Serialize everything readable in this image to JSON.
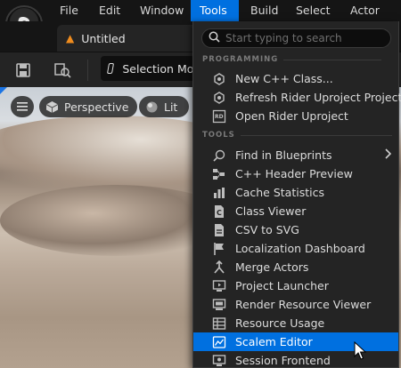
{
  "menubar": {
    "items": [
      {
        "label": "File"
      },
      {
        "label": "Edit"
      },
      {
        "label": "Window"
      },
      {
        "label": "Tools"
      },
      {
        "label": "Build"
      },
      {
        "label": "Select"
      },
      {
        "label": "Actor"
      }
    ],
    "active": "Tools"
  },
  "document_tab": {
    "label": "Untitled",
    "icon": "level-icon"
  },
  "toolbar": {
    "save_icon": "save-icon",
    "browse_icon": "content-browser-icon",
    "mode_label": "Selection Mode"
  },
  "viewport": {
    "menu_icon": "hamburger-icon",
    "perspective_label": "Perspective",
    "lit_label": "Lit"
  },
  "tools_menu": {
    "search_placeholder": "Start typing to search",
    "sections": [
      {
        "title": "PROGRAMMING",
        "items": [
          {
            "label": "New C++ Class...",
            "icon": "cpp-class-icon"
          },
          {
            "label": "Refresh Rider Uproject Project",
            "icon": "refresh-icon"
          },
          {
            "label": "Open Rider Uproject",
            "icon": "rider-icon"
          }
        ]
      },
      {
        "title": "TOOLS",
        "items": [
          {
            "label": "Find in Blueprints",
            "icon": "search-blueprints-icon",
            "has_submenu": true
          },
          {
            "label": "C++ Header Preview",
            "icon": "header-preview-icon"
          },
          {
            "label": "Cache Statistics",
            "icon": "statistics-icon"
          },
          {
            "label": "Class Viewer",
            "icon": "class-viewer-icon"
          },
          {
            "label": "CSV to SVG",
            "icon": "csv-icon"
          },
          {
            "label": "Localization Dashboard",
            "icon": "flag-icon"
          },
          {
            "label": "Merge Actors",
            "icon": "merge-icon"
          },
          {
            "label": "Project Launcher",
            "icon": "launcher-icon"
          },
          {
            "label": "Render Resource Viewer",
            "icon": "render-resource-icon"
          },
          {
            "label": "Resource Usage",
            "icon": "table-icon"
          },
          {
            "label": "Scalem Editor",
            "icon": "scalem-icon",
            "highlighted": true
          },
          {
            "label": "Session Frontend",
            "icon": "session-icon"
          }
        ]
      }
    ]
  },
  "colors": {
    "accent": "#0070e0",
    "menu_bg": "#242424",
    "bar_bg": "#151515"
  }
}
